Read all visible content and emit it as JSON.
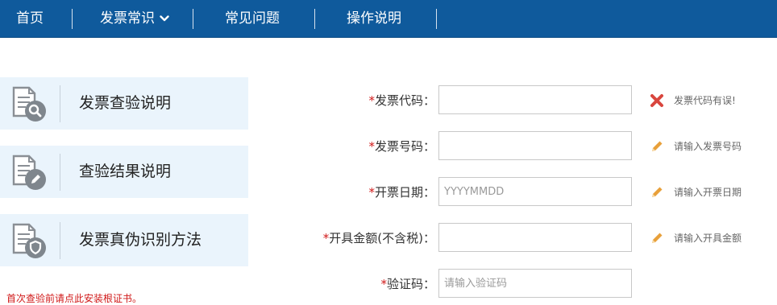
{
  "nav": {
    "items": [
      {
        "label": "首页"
      },
      {
        "label": "发票常识"
      },
      {
        "label": "常见问题"
      },
      {
        "label": "操作说明"
      }
    ]
  },
  "sidebar": {
    "items": [
      {
        "label": "发票查验说明",
        "icon": "document-search-icon"
      },
      {
        "label": "查验结果说明",
        "icon": "document-edit-icon"
      },
      {
        "label": "发票真伪识别方法",
        "icon": "document-shield-icon"
      }
    ],
    "notice": "首次查验前请点此安装根证书。"
  },
  "form": {
    "required_mark": "*",
    "fields": [
      {
        "label": "发票代码：",
        "value": "",
        "placeholder": "",
        "hint": "发票代码有误!",
        "hint_icon": "error-x-icon"
      },
      {
        "label": "发票号码：",
        "value": "",
        "placeholder": "",
        "hint": "请输入发票号码",
        "hint_icon": "pencil-icon"
      },
      {
        "label": "开票日期：",
        "value": "",
        "placeholder": "YYYYMMDD",
        "hint": "请输入开票日期",
        "hint_icon": "pencil-icon"
      },
      {
        "label": "开具金额(不含税)：",
        "value": "",
        "placeholder": "",
        "hint": "请输入开具金额",
        "hint_icon": "pencil-icon"
      },
      {
        "label": "验证码：",
        "value": "",
        "placeholder": "请输入验证码"
      }
    ]
  },
  "colors": {
    "nav_bg": "#0f5a9c",
    "side_bg": "#eaf4fc",
    "required": "#d01818",
    "error_icon": "#d9463e",
    "pencil_icon": "#e8a03a"
  }
}
